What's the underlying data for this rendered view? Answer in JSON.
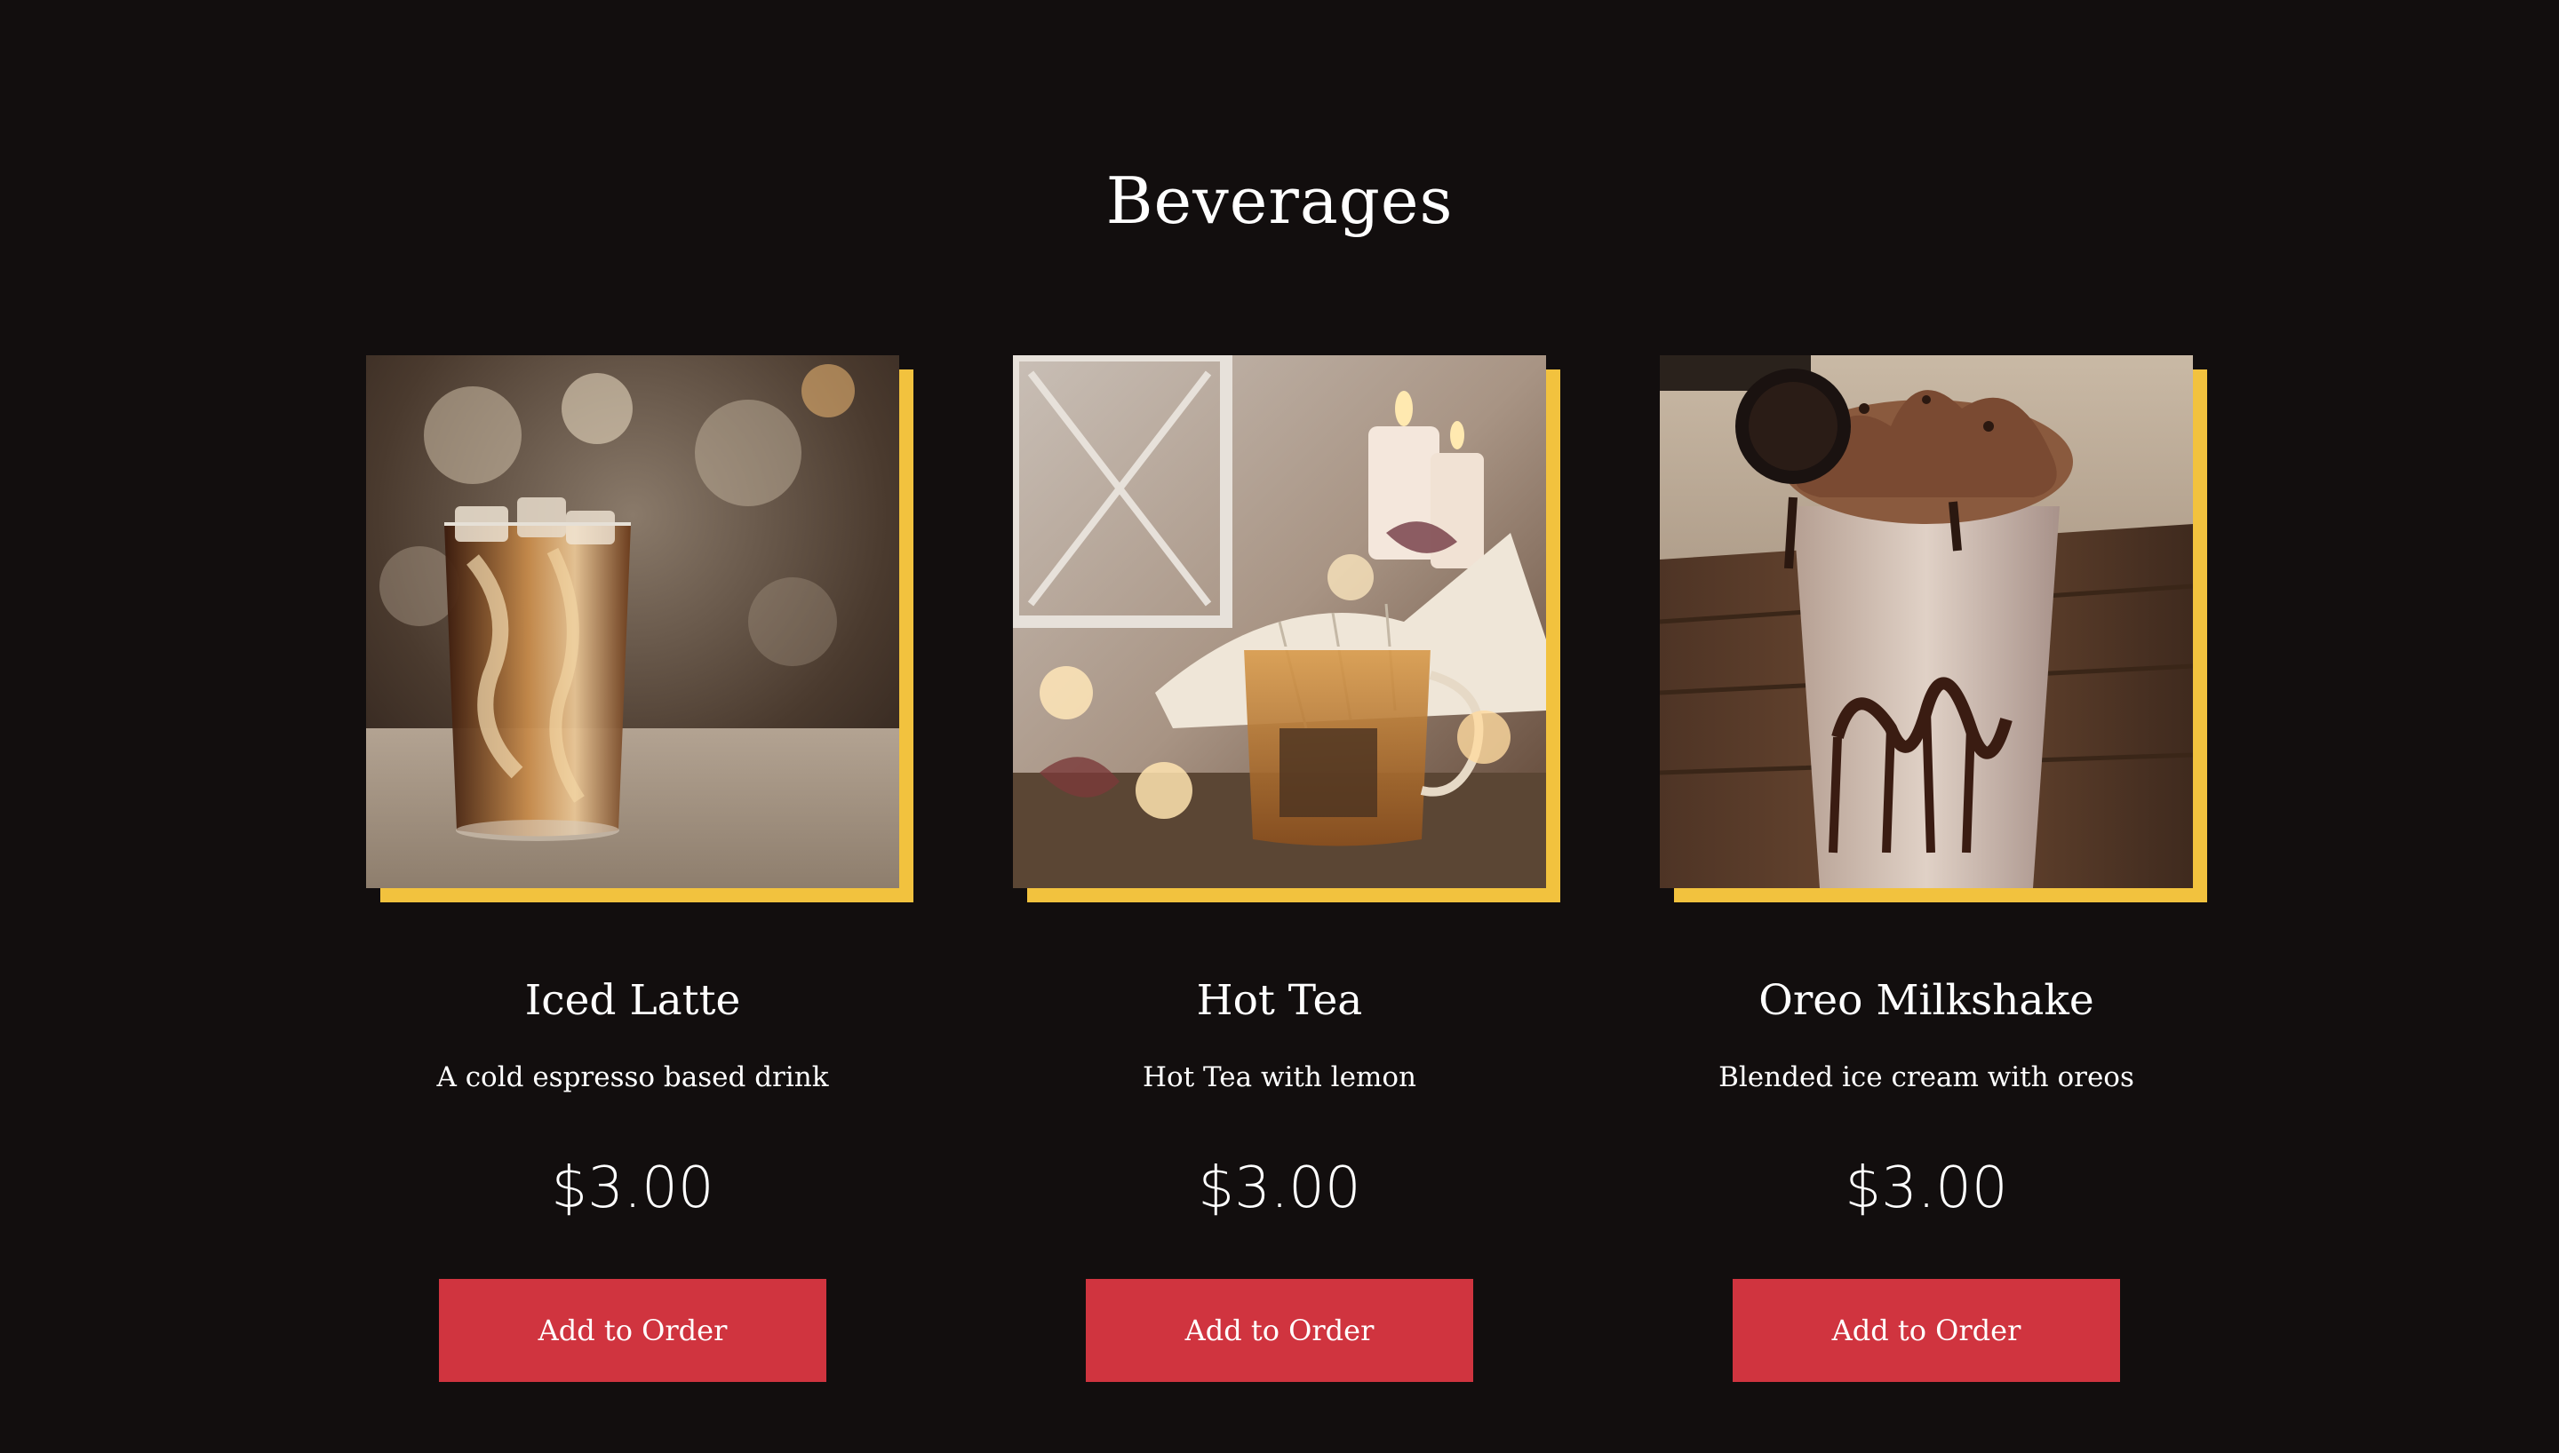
{
  "section": {
    "title": "Beverages"
  },
  "items": [
    {
      "name": "Iced Latte",
      "description": "A cold espresso based drink",
      "price": "$3.00",
      "button_label": "Add to Order",
      "image": "iced-latte-photo"
    },
    {
      "name": "Hot Tea",
      "description": "Hot Tea with lemon",
      "price": "$3.00",
      "button_label": "Add to Order",
      "image": "hot-tea-photo"
    },
    {
      "name": "Oreo Milkshake",
      "description": "Blended ice cream with oreos",
      "price": "$3.00",
      "button_label": "Add to Order",
      "image": "oreo-milkshake-photo"
    }
  ],
  "colors": {
    "background": "#120e0e",
    "accent": "#f2c23e",
    "button": "#d0343f",
    "text": "#ffffff"
  }
}
